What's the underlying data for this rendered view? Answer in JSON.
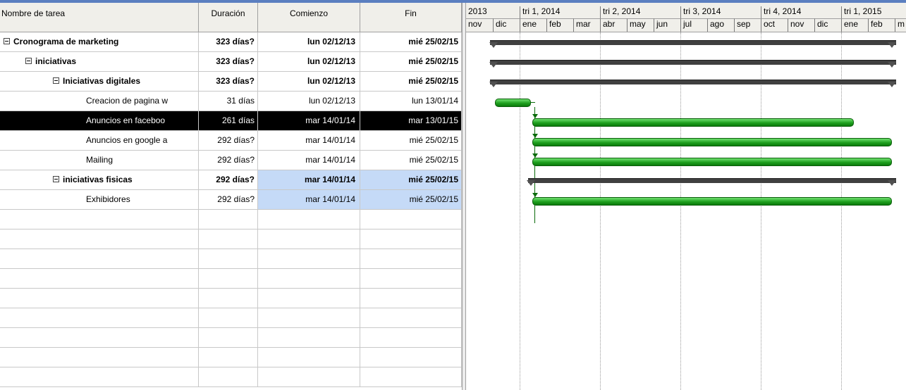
{
  "columns": {
    "name": "Nombre de tarea",
    "duration": "Duración",
    "start": "Comienzo",
    "end": "Fin"
  },
  "rows": [
    {
      "name": "Cronograma de marketing",
      "duration": "323 días?",
      "start": "lun 02/12/13",
      "end": "mié 25/02/15"
    },
    {
      "name": "iniciativas",
      "duration": "323 días?",
      "start": "lun 02/12/13",
      "end": "mié 25/02/15"
    },
    {
      "name": "Iniciativas digitales",
      "duration": "323 días?",
      "start": "lun 02/12/13",
      "end": "mié 25/02/15"
    },
    {
      "name": "Creacion de pagina w",
      "duration": "31 días",
      "start": "lun 02/12/13",
      "end": "lun 13/01/14"
    },
    {
      "name": "Anuncios en faceboo",
      "duration": "261 días",
      "start": "mar 14/01/14",
      "end": "mar 13/01/15"
    },
    {
      "name": "Anuncios en google a",
      "duration": "292 días?",
      "start": "mar 14/01/14",
      "end": "mié 25/02/15"
    },
    {
      "name": "Mailing",
      "duration": "292 días?",
      "start": "mar 14/01/14",
      "end": "mié 25/02/15"
    },
    {
      "name": "iniciativas fisicas",
      "duration": "292 días?",
      "start": "mar 14/01/14",
      "end": "mié 25/02/15"
    },
    {
      "name": "Exhibidores",
      "duration": "292 días?",
      "start": "mar 14/01/14",
      "end": "mié 25/02/15"
    }
  ],
  "timescale": {
    "quarters": [
      "2013",
      "tri 1, 2014",
      "tri 2, 2014",
      "tri 3, 2014",
      "tri 4, 2014",
      "tri 1, 2015"
    ],
    "months": [
      "nov",
      "dic",
      "ene",
      "feb",
      "mar",
      "abr",
      "may",
      "jun",
      "jul",
      "ago",
      "sep",
      "oct",
      "nov",
      "dic",
      "ene",
      "feb",
      "m"
    ]
  },
  "colors": {
    "task_bar": "#1fa01f",
    "summary_bar": "#404040",
    "selected_row": "#000000",
    "highlight": "#c5daf7",
    "header_bg": "#f0efea"
  }
}
